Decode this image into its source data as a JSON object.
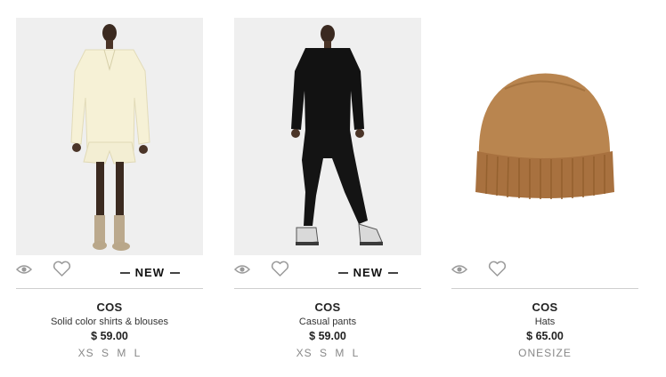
{
  "products": [
    {
      "badge": "NEW",
      "brand": "COS",
      "name": "Solid color shirts & blouses",
      "price": "$ 59.00",
      "sizes": "XS S M L",
      "image": "model-cream-shirt-shorts"
    },
    {
      "badge": "NEW",
      "brand": "COS",
      "name": "Casual pants",
      "price": "$ 59.00",
      "sizes": "XS S M L",
      "image": "model-black-sweatshirt-pants"
    },
    {
      "badge": "",
      "brand": "COS",
      "name": "Hats",
      "price": "$ 65.00",
      "sizes": "ONESIZE",
      "image": "camel-beanie-hat"
    }
  ],
  "colors": {
    "divider": "#cfcfcf",
    "icon": "#9a9a9a",
    "sizes": "#888888",
    "image_bg": "#efefef"
  },
  "icons": [
    "eye-icon",
    "heart-icon"
  ]
}
